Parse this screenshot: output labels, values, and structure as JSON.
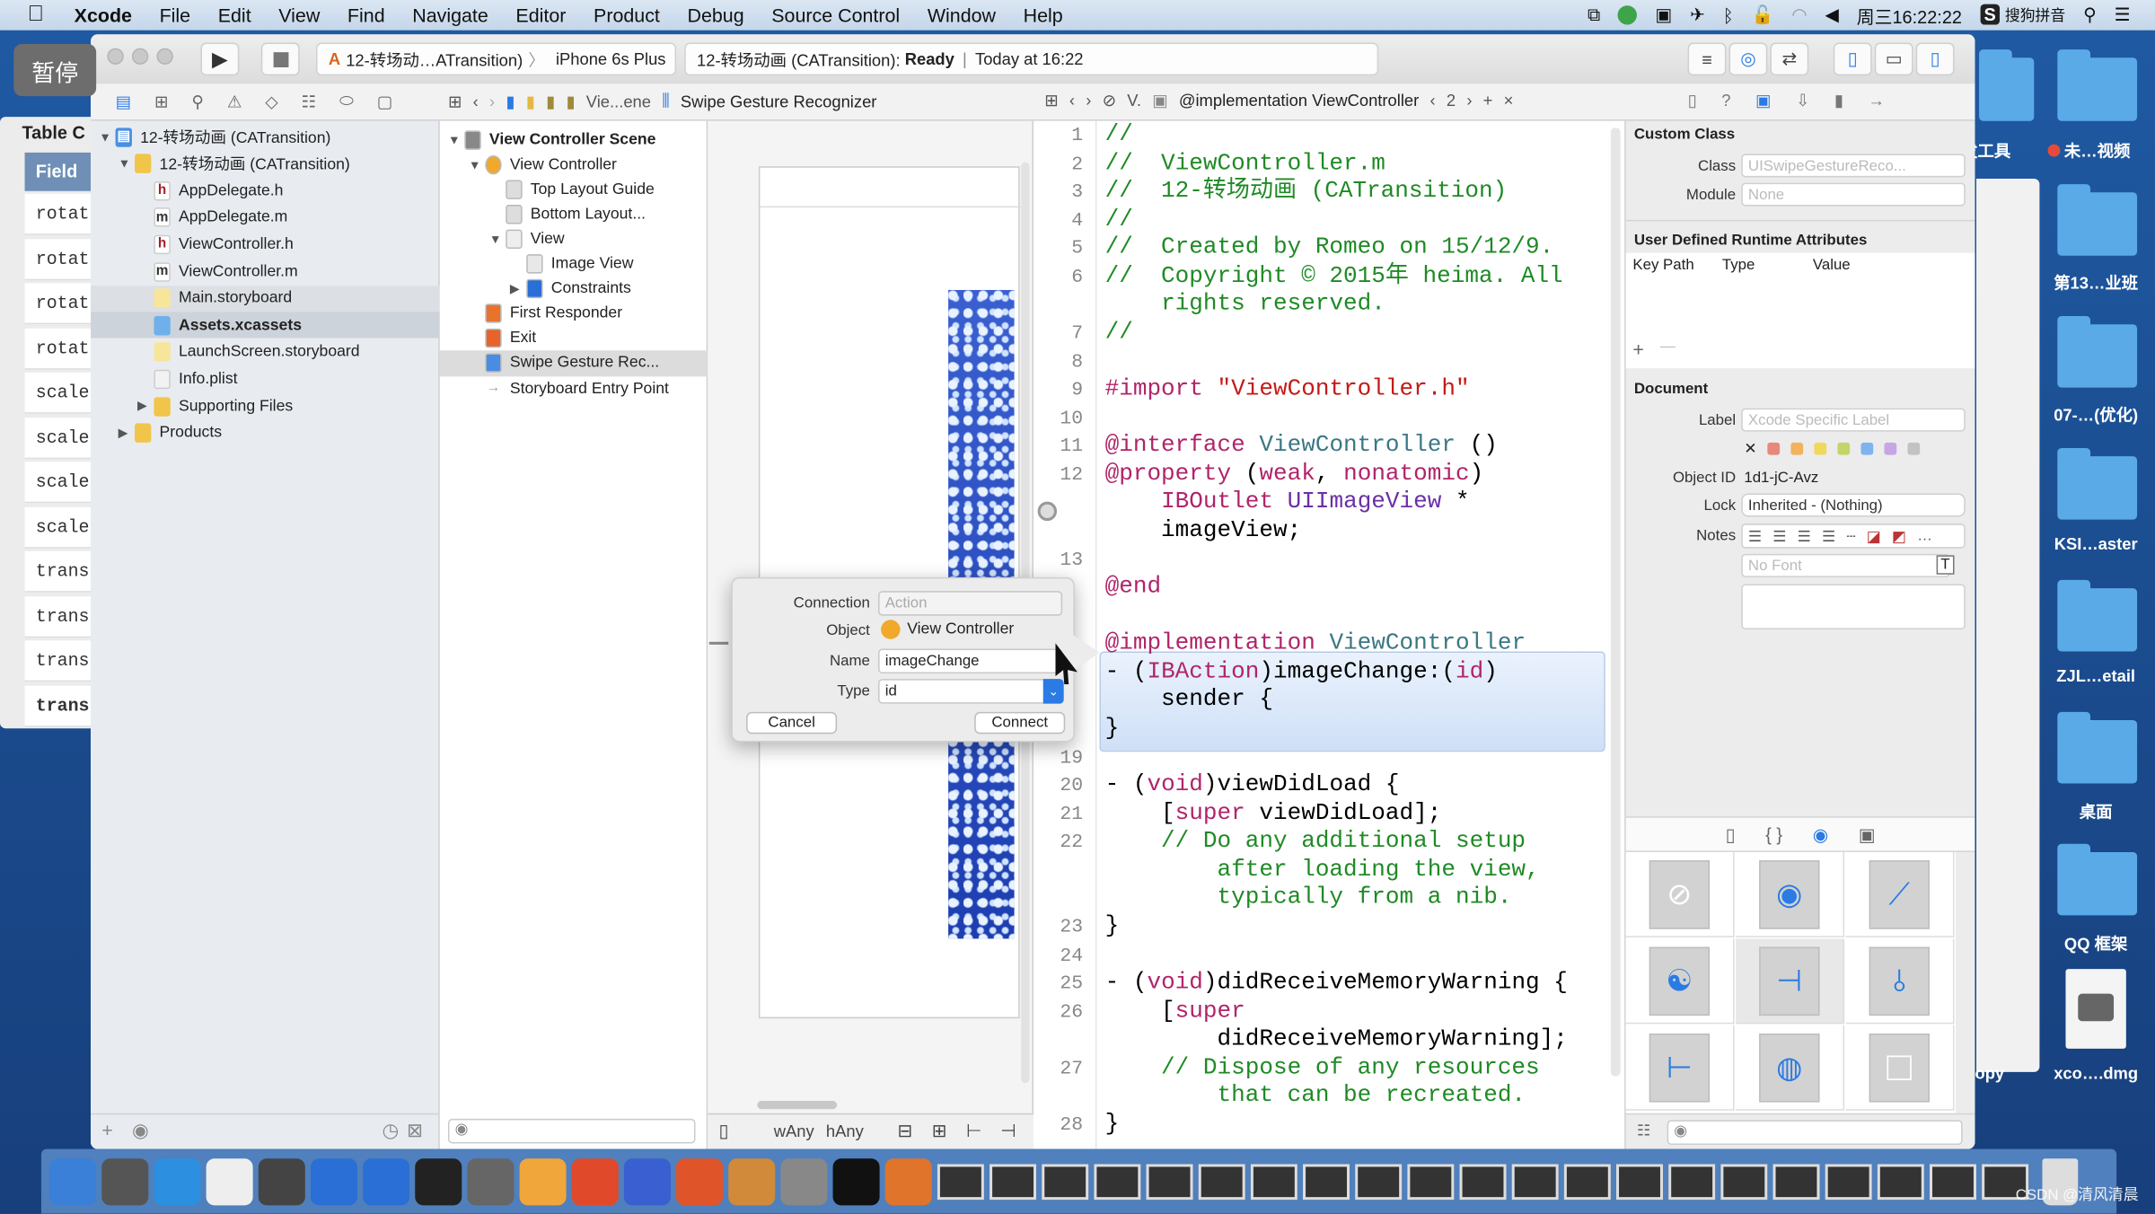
{
  "menubar": {
    "apple": "",
    "app": "Xcode",
    "items": [
      "File",
      "Edit",
      "View",
      "Find",
      "Navigate",
      "Editor",
      "Product",
      "Debug",
      "Source Control",
      "Window",
      "Help"
    ],
    "clock": "周三16:22:22",
    "ime": "搜狗拼音"
  },
  "overlay": {
    "pause_label": "暂停"
  },
  "back_window": {
    "title": "Table C",
    "header": "Field",
    "rows": [
      "rotat",
      "rotat",
      "rotat",
      "rotat",
      "scale",
      "scale",
      "scale",
      "scale",
      "trans",
      "trans",
      "trans",
      "transla"
    ]
  },
  "toolbar": {
    "scheme": "12-转场动…ATransition)",
    "device": "iPhone 6s Plus",
    "status_project": "12-转场动画 (CATransition):",
    "status_state": "Ready",
    "status_time": "Today at 16:22"
  },
  "jumpbar": {
    "canvas_crumb": "Vie...ene",
    "canvas_item": "Swipe Gesture Recognizer",
    "editor_crumb": "V.",
    "editor_item": "@implementation ViewController",
    "counterpart": "2"
  },
  "navigator": {
    "items": [
      {
        "label": "12-转场动画 (CATransition)",
        "type": "project",
        "depth": 0,
        "expanded": true
      },
      {
        "label": "12-转场动画 (CATransition)",
        "type": "folder",
        "depth": 1,
        "expanded": true
      },
      {
        "label": "AppDelegate.h",
        "type": "h",
        "depth": 2
      },
      {
        "label": "AppDelegate.m",
        "type": "m",
        "depth": 2
      },
      {
        "label": "ViewController.h",
        "type": "h",
        "depth": 2
      },
      {
        "label": "ViewController.m",
        "type": "m",
        "depth": 2
      },
      {
        "label": "Main.storyboard",
        "type": "storyboard",
        "depth": 2,
        "state": "open"
      },
      {
        "label": "Assets.xcassets",
        "type": "assets",
        "depth": 2,
        "state": "selected"
      },
      {
        "label": "LaunchScreen.storyboard",
        "type": "storyboard",
        "depth": 2
      },
      {
        "label": "Info.plist",
        "type": "plist",
        "depth": 2
      },
      {
        "label": "Supporting Files",
        "type": "folder",
        "depth": 2,
        "expanded": false
      },
      {
        "label": "Products",
        "type": "folder",
        "depth": 1,
        "expanded": false
      }
    ]
  },
  "outline": {
    "items": [
      {
        "label": "View Controller Scene",
        "depth": 0,
        "expanded": true,
        "bold": true
      },
      {
        "label": "View Controller",
        "depth": 1,
        "expanded": true
      },
      {
        "label": "Top Layout Guide",
        "depth": 2
      },
      {
        "label": "Bottom Layout...",
        "depth": 2
      },
      {
        "label": "View",
        "depth": 2,
        "expanded": true
      },
      {
        "label": "Image View",
        "depth": 3
      },
      {
        "label": "Constraints",
        "depth": 3,
        "expanded": false
      },
      {
        "label": "First Responder",
        "depth": 1
      },
      {
        "label": "Exit",
        "depth": 1
      },
      {
        "label": "Swipe Gesture Rec...",
        "depth": 1,
        "selected": true
      },
      {
        "label": "Storyboard Entry Point",
        "depth": 1
      }
    ]
  },
  "canvas": {
    "size_class_w": "wAny",
    "size_class_h": "hAny"
  },
  "code_lines": [
    {
      "num": "1",
      "rows": [
        [
          [
            "//",
            "comment"
          ]
        ]
      ]
    },
    {
      "num": "2",
      "rows": [
        [
          [
            "//  ViewController.m",
            "comment"
          ]
        ]
      ]
    },
    {
      "num": "3",
      "rows": [
        [
          [
            "//  12-转场动画 (CATransition)",
            "comment"
          ]
        ]
      ]
    },
    {
      "num": "4",
      "rows": [
        [
          [
            "//",
            "comment"
          ]
        ]
      ]
    },
    {
      "num": "5",
      "rows": [
        [
          [
            "//  Created by Romeo on 15/12/9.",
            "comment"
          ]
        ]
      ]
    },
    {
      "num": "6",
      "rows": [
        [
          [
            "//  Copyright © 2015年 heima. All",
            "comment"
          ]
        ],
        [
          [
            "//  ",
            "hidden"
          ],
          [
            "rights reserved.",
            "comment"
          ]
        ]
      ]
    },
    {
      "num": "7",
      "rows": [
        [
          [
            "//",
            "comment"
          ]
        ]
      ]
    },
    {
      "num": "8",
      "rows": [
        []
      ]
    },
    {
      "num": "9",
      "rows": [
        [
          [
            "#import ",
            "kw"
          ],
          [
            "\"ViewController.h\"",
            "str"
          ]
        ]
      ]
    },
    {
      "num": "10",
      "rows": [
        []
      ]
    },
    {
      "num": "11",
      "rows": [
        [
          [
            "@interface ",
            "kw"
          ],
          [
            "ViewController",
            "type"
          ],
          [
            " ()",
            "plain"
          ]
        ]
      ]
    },
    {
      "num": "12",
      "rows": [
        [
          [
            "@property ",
            "kw"
          ],
          [
            "(",
            "plain"
          ],
          [
            "weak",
            "kw"
          ],
          [
            ", ",
            "plain"
          ],
          [
            "nonatomic",
            "kw"
          ],
          [
            ")",
            "plain"
          ]
        ],
        [
          [
            "    ",
            "plain"
          ],
          [
            "IBOutlet ",
            "kw"
          ],
          [
            "UIImageView",
            "cls"
          ],
          [
            " *",
            "plain"
          ]
        ],
        [
          [
            "    imageView;",
            "plain"
          ]
        ]
      ]
    },
    {
      "num": "13",
      "rows": [
        []
      ]
    },
    {
      "num": "",
      "rows": [
        [
          [
            "@end",
            "kw"
          ]
        ]
      ]
    },
    {
      "num": "",
      "rows": [
        []
      ]
    },
    {
      "num": "",
      "rows": [
        [
          [
            "@implementation ",
            "kw"
          ],
          [
            "ViewController",
            "type"
          ]
        ]
      ]
    },
    {
      "num": "",
      "rows": [
        [
          [
            "- (",
            "plain"
          ],
          [
            "IBAction",
            "kw"
          ],
          [
            ")imageChange:(",
            "plain"
          ],
          [
            "id",
            "kw"
          ],
          [
            ")",
            "plain"
          ]
        ],
        [
          [
            "    sender {",
            "plain"
          ]
        ]
      ]
    },
    {
      "num": "",
      "rows": [
        [
          [
            "}",
            "plain"
          ]
        ]
      ]
    },
    {
      "num": "19",
      "rows": [
        []
      ]
    },
    {
      "num": "20",
      "rows": [
        [
          [
            "- (",
            "plain"
          ],
          [
            "void",
            "kw"
          ],
          [
            ")viewDidLoad {",
            "plain"
          ]
        ]
      ]
    },
    {
      "num": "21",
      "rows": [
        [
          [
            "    [",
            "plain"
          ],
          [
            "super",
            "kw"
          ],
          [
            " viewDidLoad];",
            "plain"
          ]
        ]
      ]
    },
    {
      "num": "22",
      "rows": [
        [
          [
            "    // Do any additional setup",
            "comment"
          ]
        ],
        [
          [
            "        after loading the view,",
            "comment"
          ]
        ],
        [
          [
            "        typically from a nib.",
            "comment"
          ]
        ]
      ]
    },
    {
      "num": "23",
      "rows": [
        [
          [
            "}",
            "plain"
          ]
        ]
      ]
    },
    {
      "num": "24",
      "rows": [
        []
      ]
    },
    {
      "num": "25",
      "rows": [
        [
          [
            "- (",
            "plain"
          ],
          [
            "void",
            "kw"
          ],
          [
            ")didReceiveMemoryWarning {",
            "plain"
          ]
        ]
      ]
    },
    {
      "num": "26",
      "rows": [
        [
          [
            "    [",
            "plain"
          ],
          [
            "super",
            "kw"
          ]
        ],
        [
          [
            "        didReceiveMemoryWarning];",
            "plain"
          ]
        ]
      ]
    },
    {
      "num": "27",
      "rows": [
        [
          [
            "    // Dispose of any resources",
            "comment"
          ]
        ],
        [
          [
            "        that can be recreated.",
            "comment"
          ]
        ]
      ]
    },
    {
      "num": "28",
      "rows": [
        [
          [
            "}",
            "plain"
          ]
        ]
      ]
    }
  ],
  "popup": {
    "connection_label": "Connection",
    "connection_value": "Action",
    "object_label": "Object",
    "object_value": "View Controller",
    "name_label": "Name",
    "name_value": "imageChange",
    "type_label": "Type",
    "type_value": "id",
    "cancel": "Cancel",
    "connect": "Connect"
  },
  "inspector": {
    "custom_class": {
      "title": "Custom Class",
      "class_label": "Class",
      "class_placeholder": "UISwipeGestureReco...",
      "module_label": "Module",
      "module_placeholder": "None"
    },
    "runtime_attrs": {
      "title": "User Defined Runtime Attributes",
      "columns": [
        "Key Path",
        "Type",
        "Value"
      ],
      "add": "+",
      "remove": "—"
    },
    "document": {
      "title": "Document",
      "label_label": "Label",
      "label_placeholder": "Xcode Specific Label",
      "object_id_label": "Object ID",
      "object_id": "1d1-jC-Avz",
      "lock_label": "Lock",
      "lock_value": "Inherited - (Nothing)",
      "notes_label": "Notes",
      "font_placeholder": "No Font",
      "label_colors": [
        "#e8877b",
        "#f2b25e",
        "#f0d85c",
        "#c4d468",
        "#7fb3ef",
        "#c7a6e6",
        "#c2c2c2"
      ]
    },
    "library_icons": [
      "compass",
      "tap",
      "pinch",
      "rotation",
      "swipe",
      "pan",
      "screen-edge-pan",
      "long-press",
      "custom"
    ]
  },
  "desktop": {
    "items": [
      "发工具",
      "未…视频",
      "第13…业班",
      "07-…(优化)",
      "KSI…aster",
      "ZJL…etail",
      "桌面",
      "QQ 框架",
      "xco….dmg",
      "opy"
    ]
  },
  "watermark": "CSDN @清风清晨",
  "colors": {
    "accent": "#2a7be4",
    "desktop": "#1b4d8f",
    "comment": "#1f8a25",
    "keyword": "#b0246a"
  }
}
